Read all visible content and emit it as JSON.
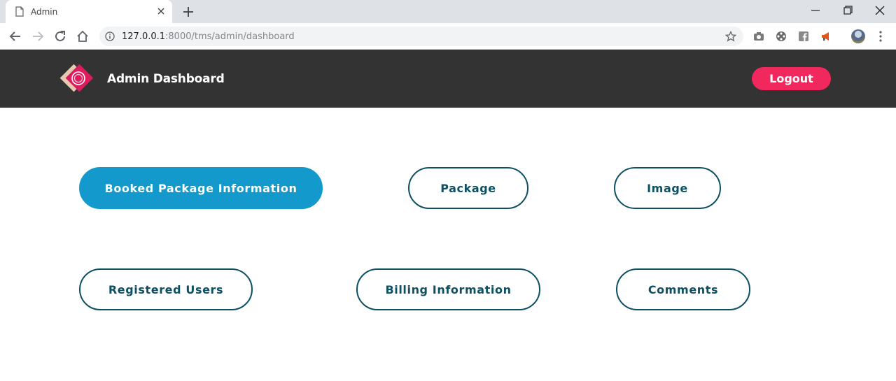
{
  "browser": {
    "tab_title": "Admin",
    "url_host": "127.0.0.1",
    "url_rest": ":8000/tms/admin/dashboard"
  },
  "header": {
    "brand": "Admin Dashboard",
    "logout_label": "Logout"
  },
  "dashboard": {
    "buttons": [
      {
        "label": "Booked Package Information",
        "active": true
      },
      {
        "label": "Package"
      },
      {
        "label": "Image"
      },
      {
        "label": "Registered Users"
      },
      {
        "label": "Billing Information"
      },
      {
        "label": "Comments"
      }
    ]
  },
  "colors": {
    "header_bg": "#333333",
    "accent_pink": "#f0285e",
    "active_blue": "#1499cc",
    "outline_teal": "#0d4f63"
  }
}
